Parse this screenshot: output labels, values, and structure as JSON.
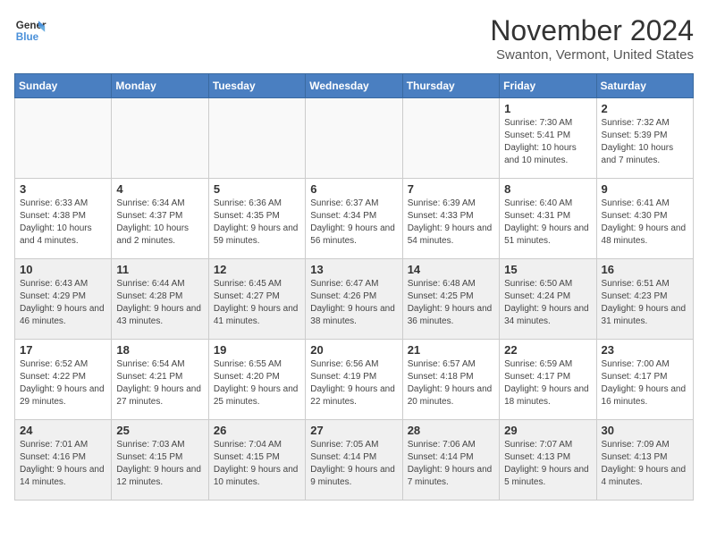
{
  "logo": {
    "line1": "General",
    "line2": "Blue"
  },
  "title": "November 2024",
  "location": "Swanton, Vermont, United States",
  "days_of_week": [
    "Sunday",
    "Monday",
    "Tuesday",
    "Wednesday",
    "Thursday",
    "Friday",
    "Saturday"
  ],
  "weeks": [
    [
      {
        "day": "",
        "info": ""
      },
      {
        "day": "",
        "info": ""
      },
      {
        "day": "",
        "info": ""
      },
      {
        "day": "",
        "info": ""
      },
      {
        "day": "",
        "info": ""
      },
      {
        "day": "1",
        "info": "Sunrise: 7:30 AM\nSunset: 5:41 PM\nDaylight: 10 hours and 10 minutes."
      },
      {
        "day": "2",
        "info": "Sunrise: 7:32 AM\nSunset: 5:39 PM\nDaylight: 10 hours and 7 minutes."
      }
    ],
    [
      {
        "day": "3",
        "info": "Sunrise: 6:33 AM\nSunset: 4:38 PM\nDaylight: 10 hours and 4 minutes."
      },
      {
        "day": "4",
        "info": "Sunrise: 6:34 AM\nSunset: 4:37 PM\nDaylight: 10 hours and 2 minutes."
      },
      {
        "day": "5",
        "info": "Sunrise: 6:36 AM\nSunset: 4:35 PM\nDaylight: 9 hours and 59 minutes."
      },
      {
        "day": "6",
        "info": "Sunrise: 6:37 AM\nSunset: 4:34 PM\nDaylight: 9 hours and 56 minutes."
      },
      {
        "day": "7",
        "info": "Sunrise: 6:39 AM\nSunset: 4:33 PM\nDaylight: 9 hours and 54 minutes."
      },
      {
        "day": "8",
        "info": "Sunrise: 6:40 AM\nSunset: 4:31 PM\nDaylight: 9 hours and 51 minutes."
      },
      {
        "day": "9",
        "info": "Sunrise: 6:41 AM\nSunset: 4:30 PM\nDaylight: 9 hours and 48 minutes."
      }
    ],
    [
      {
        "day": "10",
        "info": "Sunrise: 6:43 AM\nSunset: 4:29 PM\nDaylight: 9 hours and 46 minutes."
      },
      {
        "day": "11",
        "info": "Sunrise: 6:44 AM\nSunset: 4:28 PM\nDaylight: 9 hours and 43 minutes."
      },
      {
        "day": "12",
        "info": "Sunrise: 6:45 AM\nSunset: 4:27 PM\nDaylight: 9 hours and 41 minutes."
      },
      {
        "day": "13",
        "info": "Sunrise: 6:47 AM\nSunset: 4:26 PM\nDaylight: 9 hours and 38 minutes."
      },
      {
        "day": "14",
        "info": "Sunrise: 6:48 AM\nSunset: 4:25 PM\nDaylight: 9 hours and 36 minutes."
      },
      {
        "day": "15",
        "info": "Sunrise: 6:50 AM\nSunset: 4:24 PM\nDaylight: 9 hours and 34 minutes."
      },
      {
        "day": "16",
        "info": "Sunrise: 6:51 AM\nSunset: 4:23 PM\nDaylight: 9 hours and 31 minutes."
      }
    ],
    [
      {
        "day": "17",
        "info": "Sunrise: 6:52 AM\nSunset: 4:22 PM\nDaylight: 9 hours and 29 minutes."
      },
      {
        "day": "18",
        "info": "Sunrise: 6:54 AM\nSunset: 4:21 PM\nDaylight: 9 hours and 27 minutes."
      },
      {
        "day": "19",
        "info": "Sunrise: 6:55 AM\nSunset: 4:20 PM\nDaylight: 9 hours and 25 minutes."
      },
      {
        "day": "20",
        "info": "Sunrise: 6:56 AM\nSunset: 4:19 PM\nDaylight: 9 hours and 22 minutes."
      },
      {
        "day": "21",
        "info": "Sunrise: 6:57 AM\nSunset: 4:18 PM\nDaylight: 9 hours and 20 minutes."
      },
      {
        "day": "22",
        "info": "Sunrise: 6:59 AM\nSunset: 4:17 PM\nDaylight: 9 hours and 18 minutes."
      },
      {
        "day": "23",
        "info": "Sunrise: 7:00 AM\nSunset: 4:17 PM\nDaylight: 9 hours and 16 minutes."
      }
    ],
    [
      {
        "day": "24",
        "info": "Sunrise: 7:01 AM\nSunset: 4:16 PM\nDaylight: 9 hours and 14 minutes."
      },
      {
        "day": "25",
        "info": "Sunrise: 7:03 AM\nSunset: 4:15 PM\nDaylight: 9 hours and 12 minutes."
      },
      {
        "day": "26",
        "info": "Sunrise: 7:04 AM\nSunset: 4:15 PM\nDaylight: 9 hours and 10 minutes."
      },
      {
        "day": "27",
        "info": "Sunrise: 7:05 AM\nSunset: 4:14 PM\nDaylight: 9 hours and 9 minutes."
      },
      {
        "day": "28",
        "info": "Sunrise: 7:06 AM\nSunset: 4:14 PM\nDaylight: 9 hours and 7 minutes."
      },
      {
        "day": "29",
        "info": "Sunrise: 7:07 AM\nSunset: 4:13 PM\nDaylight: 9 hours and 5 minutes."
      },
      {
        "day": "30",
        "info": "Sunrise: 7:09 AM\nSunset: 4:13 PM\nDaylight: 9 hours and 4 minutes."
      }
    ]
  ]
}
